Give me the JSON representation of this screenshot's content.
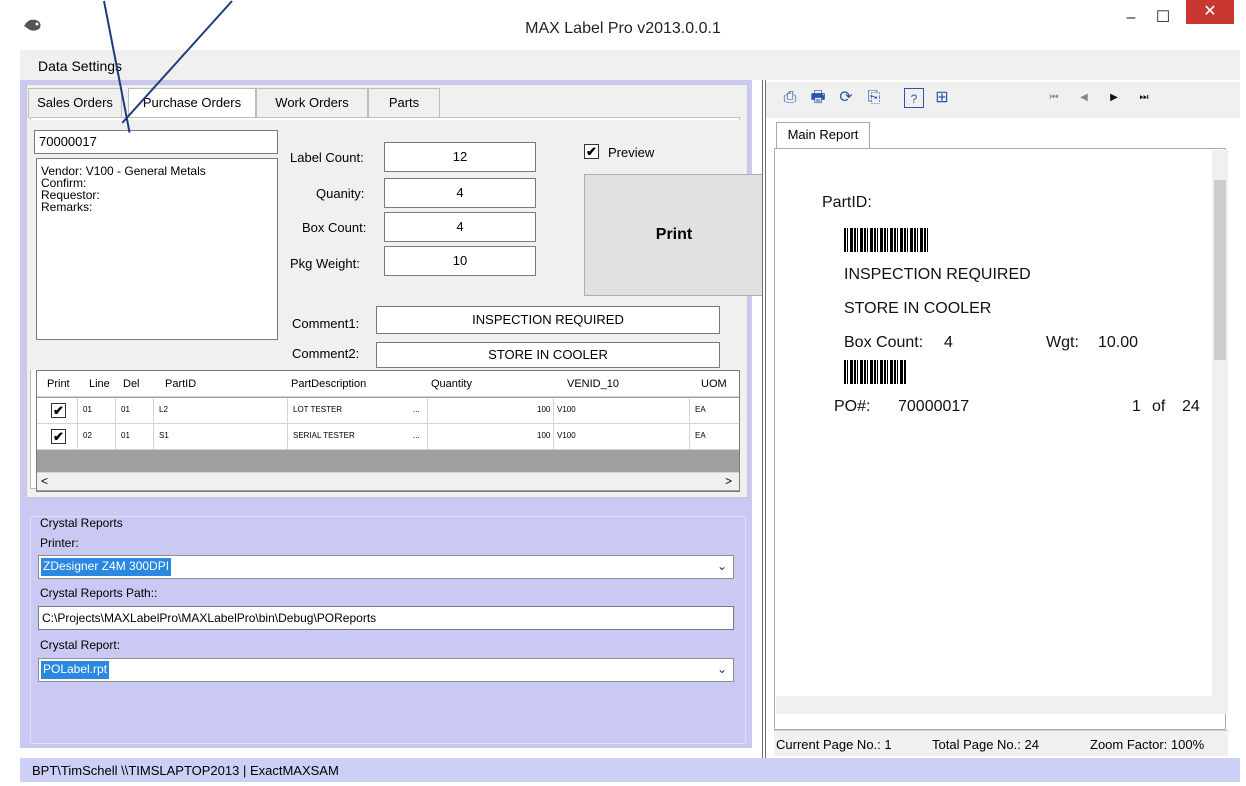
{
  "window": {
    "title": "MAX Label Pro v2013.0.0.1",
    "minimize": "–",
    "maximize": "☐",
    "close": "✕"
  },
  "menu": {
    "data_settings": "Data Settings"
  },
  "tabs": [
    "Sales Orders",
    "Purchase Orders",
    "Work Orders",
    "Parts"
  ],
  "order": {
    "number": "70000017",
    "info_lines": [
      "Vendor:  V100 - General Metals",
      "Confirm:",
      "Requestor:",
      "Remarks:"
    ]
  },
  "fields": {
    "label_count_label": "Label Count:",
    "label_count": "12",
    "quantity_label": "Quanity:",
    "quantity": "4",
    "box_count_label": "Box Count:",
    "box_count": "4",
    "pkg_weight_label": "Pkg Weight:",
    "pkg_weight": "10",
    "comment1_label": "Comment1:",
    "comment1": "INSPECTION REQUIRED",
    "comment2_label": "Comment2:",
    "comment2": "STORE IN COOLER"
  },
  "preview": {
    "label": "Preview",
    "checked": true
  },
  "print_button": "Print",
  "grid": {
    "headers": [
      "Print",
      "Line",
      "Del",
      "PartID",
      "PartDescription",
      "Quantity",
      "VENID_10",
      "UOM"
    ],
    "rows": [
      {
        "print": "✔",
        "line": "01",
        "del": "01",
        "partid": "L2",
        "desc": "LOT TESTER",
        "ellipsis": "...",
        "qty": "100",
        "venid": "V100",
        "uom": "EA"
      },
      {
        "print": "✔",
        "line": "02",
        "del": "01",
        "partid": "S1",
        "desc": "SERIAL TESTER",
        "ellipsis": "...",
        "qty": "100",
        "venid": "V100",
        "uom": "EA"
      }
    ],
    "scroll_left": "<",
    "scroll_right": ">"
  },
  "crystal": {
    "group_title": "Crystal Reports",
    "printer_label": "Printer:",
    "printer_value": "ZDesigner Z4M 300DPI",
    "path_label": "Crystal Reports Path::",
    "path_value": "C:\\Projects\\MAXLabelPro\\MAXLabelPro\\bin\\Debug\\POReports",
    "report_label": "Crystal Report:",
    "report_value": "POLabel.rpt",
    "dropdown_arrow": "⌄"
  },
  "status_bar": "BPT\\TimSchell  \\\\TIMSLAPTOP2013 | ExactMAXSAM",
  "report_viewer": {
    "tab": "Main Report",
    "toolbar_icons": [
      "export-icon",
      "print-icon",
      "refresh-icon",
      "copy-icon",
      "help-icon",
      "group-tree-icon",
      "first-page-icon",
      "prev-page-icon",
      "next-page-icon",
      "last-page-icon"
    ],
    "toolbar_glyphs": [
      "⎙",
      "🖶",
      "⟳",
      "⎘",
      "?",
      "⊞",
      "⏮",
      "◀",
      "▶",
      "⏭"
    ],
    "label": {
      "part_id": "PartID:",
      "line1": "INSPECTION REQUIRED",
      "line2": "STORE IN COOLER",
      "box_count_label": "Box Count:",
      "box_count": "4",
      "wgt_label": "Wgt:",
      "wgt": "10.00",
      "po_label": "PO#:",
      "po": "70000017",
      "page": "1",
      "of": "of",
      "total": "24"
    },
    "status": {
      "current_page": "Current Page No.: 1",
      "total_pages": "Total Page No.: 24",
      "zoom": "Zoom Factor: 100%"
    }
  }
}
